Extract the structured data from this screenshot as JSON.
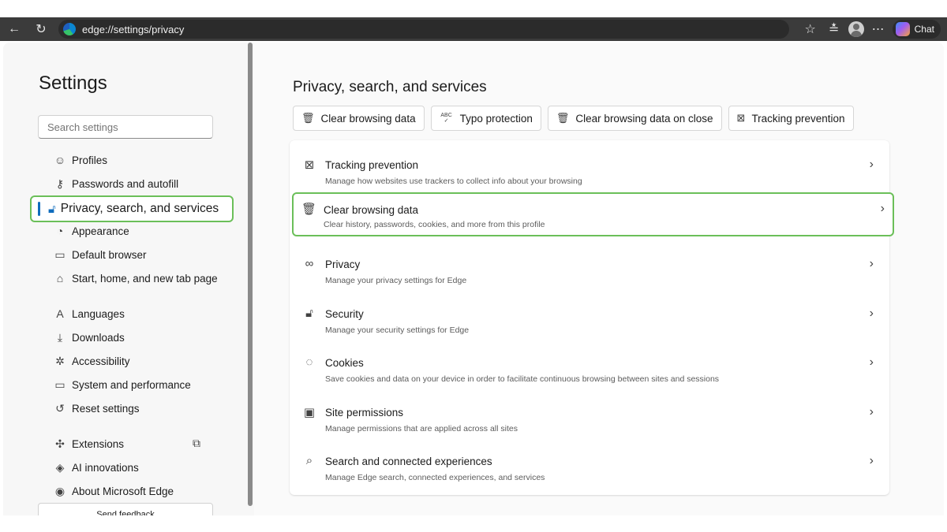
{
  "browser": {
    "url": "edge://settings/privacy",
    "chat_label": "Chat"
  },
  "sidebar": {
    "title": "Settings",
    "search_placeholder": "Search settings",
    "items": [
      {
        "label": "Profiles",
        "icon": "profile-icon"
      },
      {
        "label": "Passwords and autofill",
        "icon": "key-icon"
      },
      {
        "label": "Privacy, search, and services",
        "icon": "lock-icon",
        "active": true
      },
      {
        "label": "Appearance",
        "icon": "palette-icon"
      },
      {
        "label": "Default browser",
        "icon": "browser-icon"
      },
      {
        "label": "Start, home, and new tab page",
        "icon": "home-icon"
      },
      {
        "label": "Languages",
        "icon": "language-icon"
      },
      {
        "label": "Downloads",
        "icon": "download-icon"
      },
      {
        "label": "Accessibility",
        "icon": "accessibility-icon"
      },
      {
        "label": "System and performance",
        "icon": "laptop-icon"
      },
      {
        "label": "Reset settings",
        "icon": "reset-icon"
      },
      {
        "label": "Extensions",
        "icon": "puzzle-icon"
      },
      {
        "label": "AI innovations",
        "icon": "ai-icon"
      },
      {
        "label": "About Microsoft Edge",
        "icon": "edge-icon"
      }
    ],
    "feedback_label": "Send feedback"
  },
  "main": {
    "title": "Privacy, search, and services",
    "chips": [
      {
        "label": "Clear browsing data",
        "icon": "trash-icon"
      },
      {
        "label": "Typo protection",
        "icon": "abc-check-icon",
        "icon_text": "ABC"
      },
      {
        "label": "Clear browsing data on close",
        "icon": "trash-clock-icon"
      },
      {
        "label": "Tracking prevention",
        "icon": "tracking-icon"
      }
    ],
    "rows": [
      {
        "title": "Tracking prevention",
        "subtitle": "Manage how websites use trackers to collect info about your browsing",
        "icon": "tracking-icon"
      },
      {
        "title": "Clear browsing data",
        "subtitle": "Clear history, passwords, cookies, and more from this profile",
        "icon": "trash-icon",
        "highlighted": true
      },
      {
        "title": "Privacy",
        "subtitle": "Manage your privacy settings for Edge",
        "icon": "glasses-icon"
      },
      {
        "title": "Security",
        "subtitle": "Manage your security settings for Edge",
        "icon": "lock-icon"
      },
      {
        "title": "Cookies",
        "subtitle": "Save cookies and data on your device in order to facilitate continuous browsing between sites and sessions",
        "icon": "cookie-icon"
      },
      {
        "title": "Site permissions",
        "subtitle": "Manage permissions that are applied across all sites",
        "icon": "permissions-icon"
      },
      {
        "title": "Search and connected experiences",
        "subtitle": "Manage Edge search, connected experiences, and services",
        "icon": "search-icon"
      }
    ]
  },
  "colors": {
    "highlight_border": "#6bbf59",
    "accent": "#0f6cbd",
    "toolbar": "#3b3b3b"
  }
}
